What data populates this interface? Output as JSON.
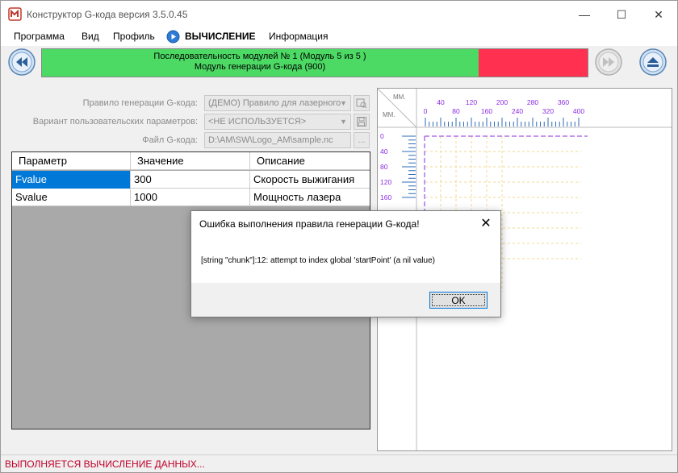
{
  "window": {
    "title": "Конструктор G-кода версия 3.5.0.45",
    "minimize_glyph": "—",
    "maximize_glyph": "☐",
    "close_glyph": "✕"
  },
  "menu": {
    "items": [
      "Программа",
      "Вид",
      "Профиль",
      "ВЫЧИСЛЕНИЕ",
      "Информация"
    ]
  },
  "toolbar": {
    "progress_line1": "Последовательность модулей № 1 (Модуль 5 из 5 )",
    "progress_line2": "Модуль генерации G-кода (900)",
    "progress_fraction": 0.8,
    "progress_color_done": "#4cd964",
    "progress_color_remaining": "#ff3050"
  },
  "form": {
    "rule_label": "Правило генерации G-кода:",
    "rule_value": "(ДЕМО) Правило для лазерного",
    "variant_label": "Вариант пользовательских параметров:",
    "variant_value": "<НЕ ИСПОЛЬЗУЕТСЯ>",
    "file_label": "Файл G-кода:",
    "file_value": "D:\\AM\\SW\\Logo_AM\\sample.nc",
    "browse_label": "..."
  },
  "grid": {
    "headers": [
      "Параметр",
      "Значение",
      "Описание"
    ],
    "rows": [
      [
        "Fvalue",
        "300",
        "Скорость выжигания"
      ],
      [
        "Svalue",
        "1000",
        "Мощность лазера"
      ]
    ]
  },
  "preview": {
    "unit_top": "ММ.",
    "unit_left": "ММ.",
    "x_ticks_top": [
      "40",
      "120",
      "200",
      "280",
      "360"
    ],
    "x_ticks_bottom": [
      "0",
      "80",
      "160",
      "240",
      "320",
      "400"
    ],
    "y_ticks": [
      "0",
      "40",
      "80",
      "120",
      "160"
    ],
    "accent_color": "#8a2be2"
  },
  "status": {
    "text": "ВЫПОЛНЯЕТСЯ ВЫЧИСЛЕНИЕ ДАННЫХ..."
  },
  "dialog": {
    "title": "Ошибка выполнения правила генерации G-кода!",
    "message": "[string \"chunk\"]:12: attempt to index global 'startPoint' (a nil value)",
    "ok_label": "OK",
    "close_glyph": "✕"
  }
}
